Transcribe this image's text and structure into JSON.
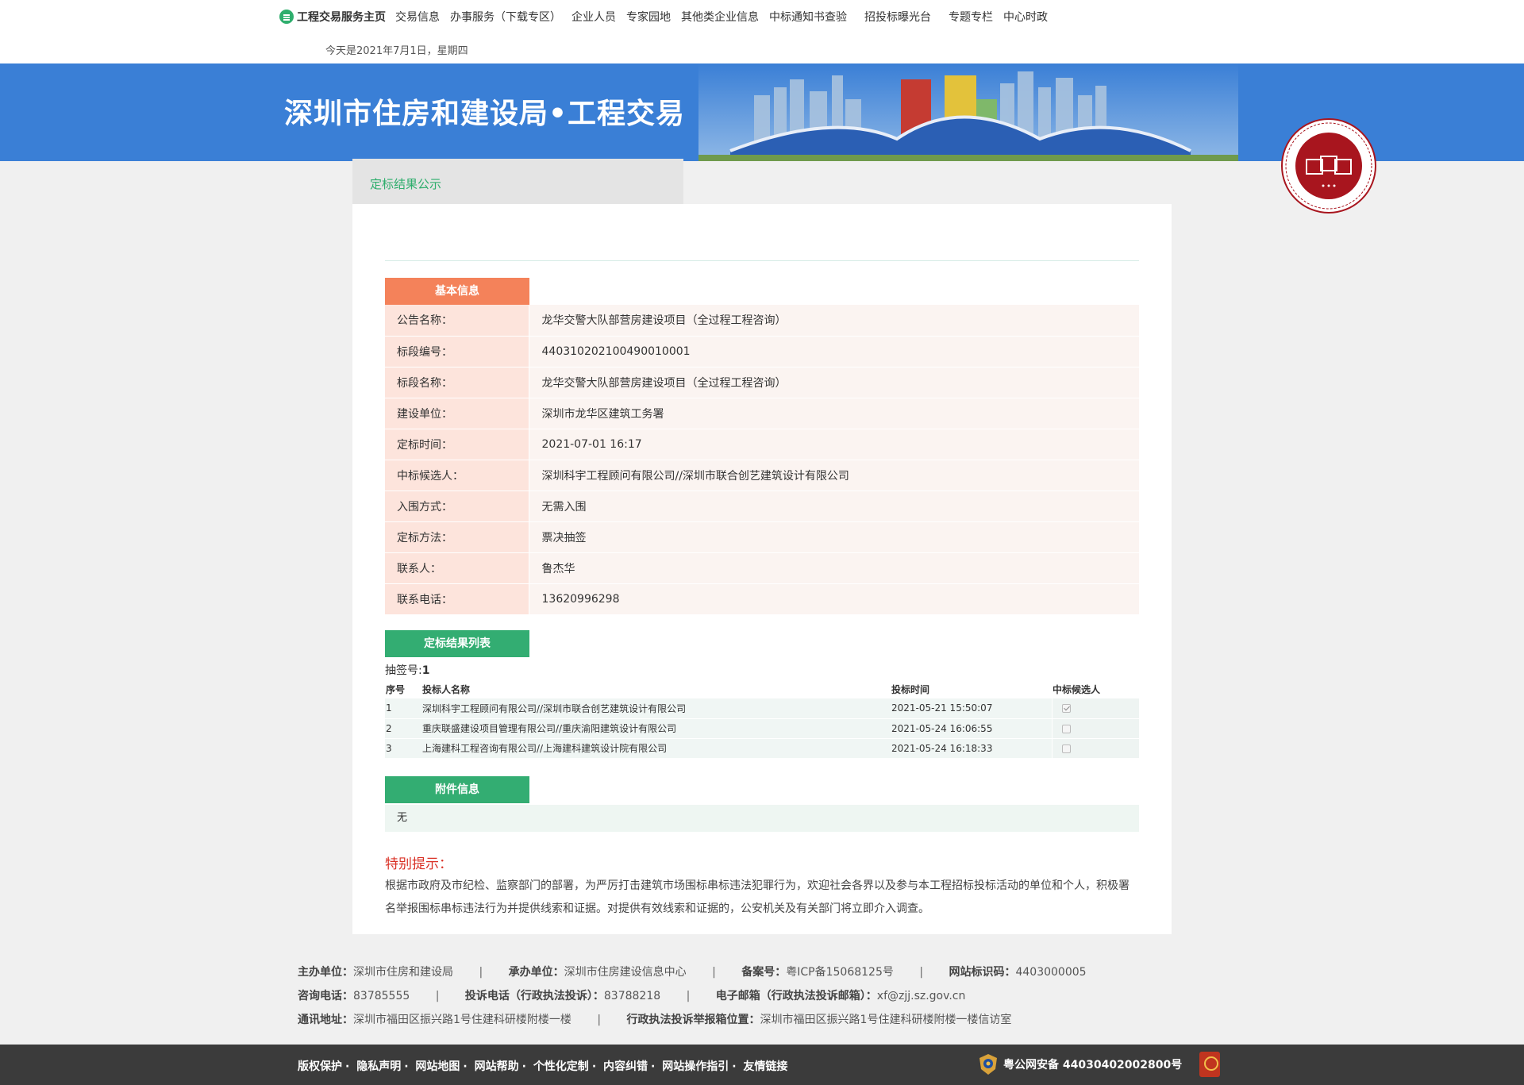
{
  "nav": {
    "home_label": "工程交易服务主页",
    "items": [
      "交易信息",
      "办事服务（下载专区）",
      "企业人员",
      "专家园地",
      "其他类企业信息",
      "中标通知书查验",
      "招投标曝光台",
      "专题专栏",
      "中心时政"
    ]
  },
  "date_line": "今天是2021年7月1日，星期四",
  "banner": {
    "title": "深圳市住房和建设局•工程交易"
  },
  "tab": {
    "label": "定标结果公示"
  },
  "basic_info": {
    "tag": "基本信息",
    "rows": [
      {
        "key": "公告名称：",
        "value": "龙华交警大队部营房建设项目（全过程工程咨询）"
      },
      {
        "key": "标段编号：",
        "value": "440310202100490010001"
      },
      {
        "key": "标段名称：",
        "value": "龙华交警大队部营房建设项目（全过程工程咨询）"
      },
      {
        "key": "建设单位：",
        "value": "深圳市龙华区建筑工务署"
      },
      {
        "key": "定标时间：",
        "value": "2021-07-01 16:17"
      },
      {
        "key": "中标候选人：",
        "value": "深圳科宇工程顾问有限公司//深圳市联合创艺建筑设计有限公司"
      },
      {
        "key": "入围方式：",
        "value": "无需入围"
      },
      {
        "key": "定标方法：",
        "value": "票决抽签"
      },
      {
        "key": "联系人：",
        "value": "鲁杰华"
      },
      {
        "key": "联系电话：",
        "value": "13620996298"
      }
    ]
  },
  "results": {
    "tag": "定标结果列表",
    "lot_label": "抽签号:",
    "lot_value": "1",
    "headers": [
      "序号",
      "投标人名称",
      "投标时间",
      "中标候选人"
    ],
    "rows": [
      {
        "no": "1",
        "name": "深圳科宇工程顾问有限公司//深圳市联合创艺建筑设计有限公司",
        "time": "2021-05-21 15:50:07",
        "selected": true
      },
      {
        "no": "2",
        "name": "重庆联盛建设项目管理有限公司//重庆渝阳建筑设计有限公司",
        "time": "2021-05-24 16:06:55",
        "selected": false
      },
      {
        "no": "3",
        "name": "上海建科工程咨询有限公司//上海建科建筑设计院有限公司",
        "time": "2021-05-24 16:18:33",
        "selected": false
      }
    ]
  },
  "attachment": {
    "tag": "附件信息",
    "value": "无"
  },
  "notice": {
    "title": "特别提示：",
    "body": "根据市政府及市纪检、监察部门的部署，为严厉打击建筑市场围标串标违法犯罪行为，欢迎社会各界以及参与本工程招标投标活动的单位和个人，积极署名举报围标串标违法行为并提供线索和证据。对提供有效线索和证据的，公安机关及有关部门将立即介入调查。"
  },
  "footer": {
    "row1": [
      {
        "label": "主办单位：",
        "value": "深圳市住房和建设局"
      },
      {
        "label": "承办单位：",
        "value": "深圳市住房建设信息中心"
      },
      {
        "label": "备案号：",
        "value": "粤ICP备15068125号"
      },
      {
        "label": "网站标识码：",
        "value": "4403000005"
      }
    ],
    "row2": [
      {
        "label": "咨询电话：",
        "value": "83785555"
      },
      {
        "label": "投诉电话（行政执法投诉）：",
        "value": "83788218"
      },
      {
        "label": "电子邮箱（行政执法投诉邮箱）：",
        "value": "xf@zjj.sz.gov.cn"
      }
    ],
    "row3": [
      {
        "label": "通讯地址：",
        "value": "深圳市福田区振兴路1号住建科研楼附楼一楼"
      },
      {
        "label": "行政执法投诉举报箱位置：",
        "value": "深圳市福田区振兴路1号住建科研楼附楼一楼信访室"
      }
    ],
    "separator": "|",
    "links": [
      "版权保护",
      "隐私声明",
      "网站地图",
      "网站帮助",
      "个性化定制",
      "内容纠错",
      "网站操作指引",
      "友情链接"
    ],
    "link_separator": "·",
    "police_record": "粤公网安备 44030402002800号"
  },
  "colors": {
    "accent_green": "#2fae6d",
    "banner_blue": "#3a7fd6",
    "tag_orange": "#f4825a",
    "notice_red": "#d93025"
  },
  "icons": {
    "home": "list-circle-icon",
    "seal": "bidding-seal-icon",
    "police": "police-badge-icon",
    "gov": "gov-error-correction-icon"
  }
}
